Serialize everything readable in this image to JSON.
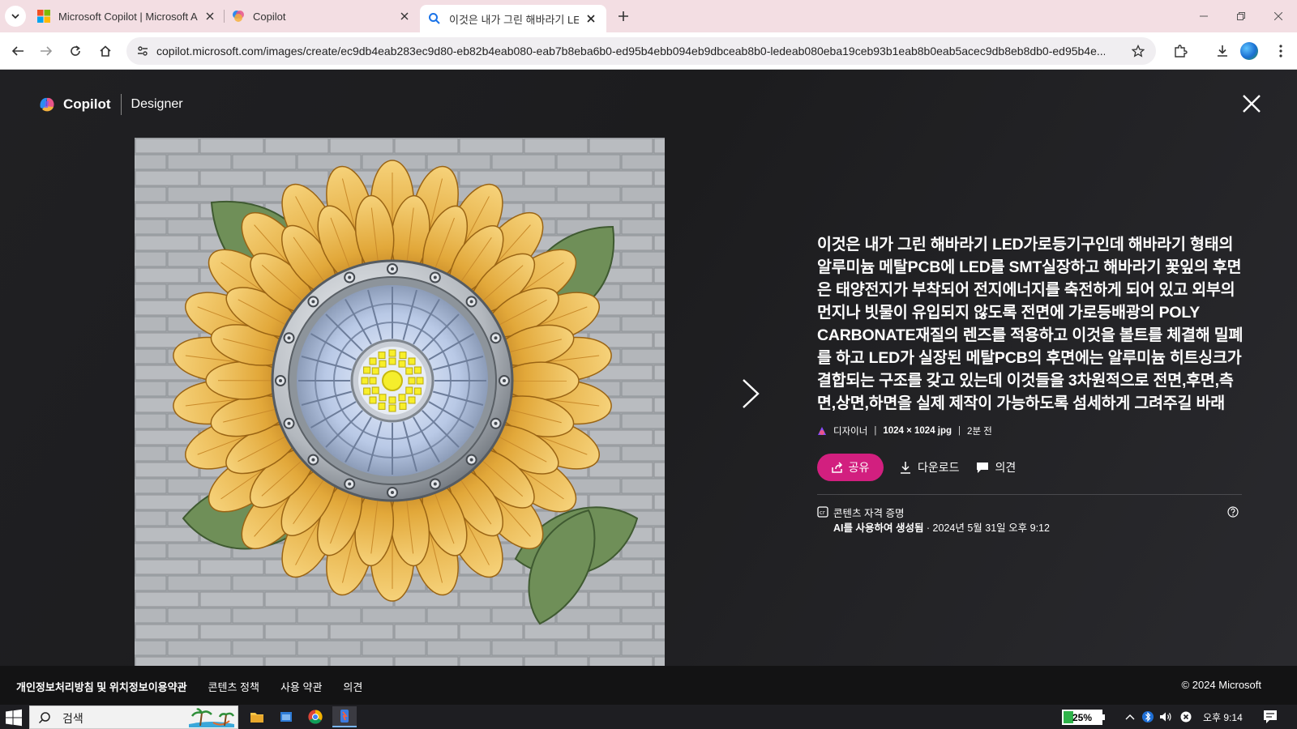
{
  "browser": {
    "tabs": [
      {
        "title": "Microsoft Copilot | Microsoft AI",
        "favicon": "microsoft-logo-icon",
        "active": false
      },
      {
        "title": "Copilot",
        "favicon": "copilot-logo-icon",
        "active": false
      },
      {
        "title": "이것은 내가 그린 해바라기 LED",
        "favicon": "search-icon",
        "active": true
      }
    ],
    "url": "copilot.microsoft.com/images/create/ec9db4eab283ec9d80-eb82b4eab080-eab7b8eba6b0-ed95b4ebb094eb9dbceab8b0-ledeab080eba19ceb93b1eab8b0eab5acec9db8eb8db0-ed95b4e..."
  },
  "header": {
    "brand": "Copilot",
    "product": "Designer"
  },
  "image": {
    "alt_icon": "sunflower-led-streetlight-image"
  },
  "details": {
    "prompt": "이것은 내가 그린 해바라기 LED가로등기구인데 해바라기 형태의 알루미늄 메탈PCB에 LED를 SMT실장하고 해바라기 꽃잎의 후면은 태양전지가 부착되어 전지에너지를 축전하게 되어 있고 외부의 먼지나 빗물이 유입되지 않도록 전면에 가로등배광의 POLY CARBONATE재질의 렌즈를 적용하고 이것을 볼트를 체결해 밀폐를 하고 LED가 실장된 메탈PCB의 후면에는 알루미늄 히트싱크가 결합되는 구조를 갖고 있는데 이것들을 3차원적으로 전면,후면,측면,상면,하면을 실제 제작이 가능하도록 섬세하게 그려주길 바래",
    "meta_source": "디자이너",
    "meta_dims": "1024 × 1024 jpg",
    "meta_time": "2분 전",
    "share_label": "공유",
    "download_label": "다운로드",
    "feedback_label": "의견",
    "credentials_title": "콘텐츠 자격 증명",
    "credentials_bold": "AI를 사용하여 생성됨",
    "credentials_date": " · 2024년 5월 31일 오후 9:12"
  },
  "footer": {
    "links": [
      "개인정보처리방침 및 위치정보이용약관",
      "콘텐츠 정책",
      "사용 약관",
      "의견"
    ],
    "copyright": "© 2024 Microsoft"
  },
  "taskbar": {
    "search_placeholder": "검색",
    "battery": "25%",
    "battery_level": 0.25,
    "clock": "오후 9:14"
  },
  "colors": {
    "accent": "#d21f7f",
    "tab_strip": "#f3dee3",
    "page_bg": "#1c1c1e"
  }
}
